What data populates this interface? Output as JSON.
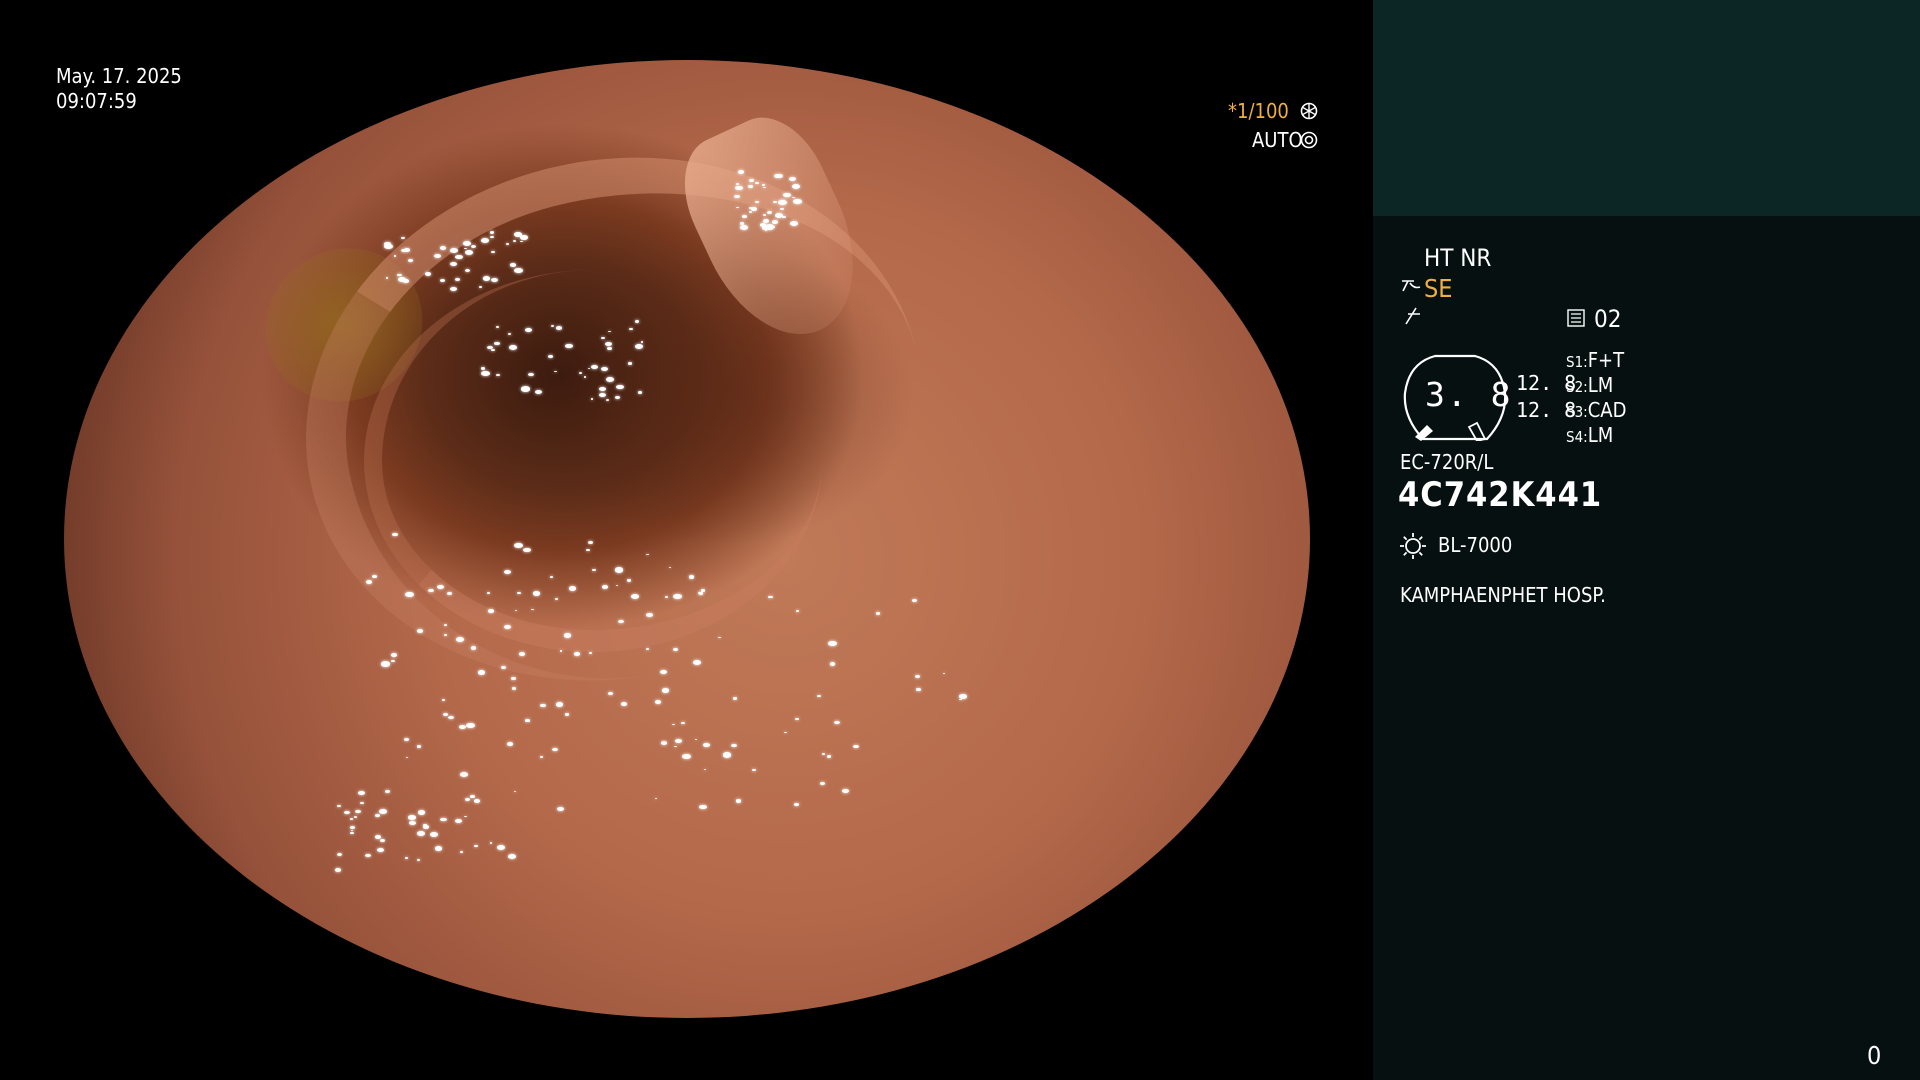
{
  "overlay": {
    "date": "May. 17. 2025",
    "time": "09:07:59",
    "shutter": "*1/100",
    "exposure_mode": "AUTO"
  },
  "panel": {
    "mode": "HT NR",
    "structure_enhance": "SE",
    "memory_label": "02",
    "dial_value": "3. 8",
    "side_value_1": "12. 8",
    "side_value_2": "12. 8",
    "switches": [
      {
        "key": "S1:",
        "value": "F+T"
      },
      {
        "key": "S2:",
        "value": "LM"
      },
      {
        "key": "S3:",
        "value": "CAD"
      },
      {
        "key": "S4:",
        "value": "LM"
      }
    ],
    "scope_model": "EC-720R/L",
    "scope_serial": "4C742K441",
    "light_source": "BL-7000",
    "hospital": "KAMPHAENPHET HOSP.",
    "counter": "0"
  },
  "colors": {
    "accent": "#f0b040",
    "panel_top": "#0c2626",
    "panel": "#061010",
    "tissue": "#b4694a"
  },
  "icons": [
    "iris-icon",
    "auto-exposure-icon",
    "se-icon",
    "enhance-icon",
    "memo-icon",
    "dial-icon",
    "light-source-icon"
  ]
}
